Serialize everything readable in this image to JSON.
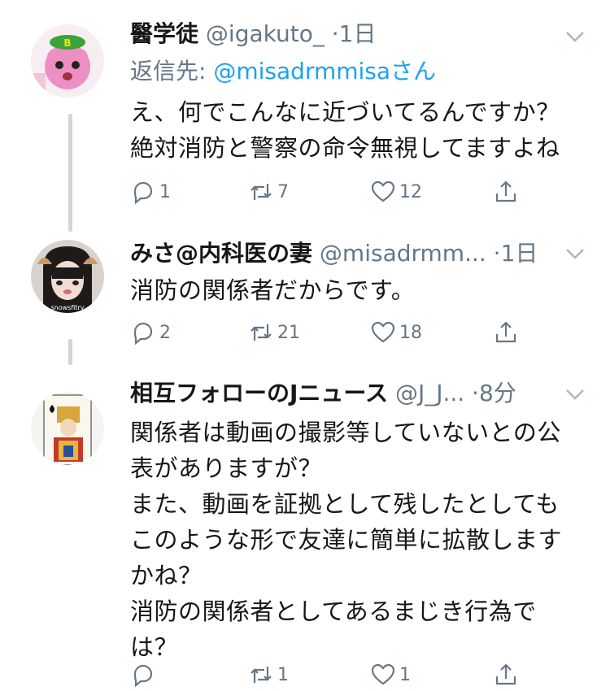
{
  "tweets": [
    {
      "name": "醫学徒",
      "handle": "@igakuto_",
      "sep": " ·",
      "time": "1日",
      "reply_label": "返信先: ",
      "reply_handle": "@misadrmmisa",
      "reply_suffix": "さん",
      "lines": [
        "え、何でこんなに近づいてるんですか？",
        "絶対消防と警察の命令無視してますよね"
      ],
      "replies": "1",
      "retweets": "7",
      "likes": "12"
    },
    {
      "name": "みさ@内科医の妻",
      "handle": "@misadrmm...",
      "sep": " ·",
      "time": "1日",
      "lines": [
        "消防の関係者だからです。"
      ],
      "replies": "2",
      "retweets": "21",
      "likes": "18",
      "avatar_text": "snowsfitry"
    },
    {
      "name": "相互フォローのJニュース",
      "handle": "@J_J...",
      "sep": " ·",
      "time": "8分",
      "lines": [
        "関係者は動画の撮影等していないとの公",
        "表がありますが？",
        "また、動画を証拠として残したとしても",
        "このような形で友達に簡単に拡散します",
        "かね？",
        "消防の関係者としてあるまじき行為で",
        "は？"
      ],
      "replies": "",
      "retweets": "1",
      "likes": "1"
    }
  ],
  "icons": [
    "reply-icon",
    "retweet-icon",
    "like-icon",
    "share-icon",
    "chevron-down-icon"
  ],
  "colors": {
    "accent": "#1da1f2",
    "muted": "#657786",
    "text": "#14171a",
    "thread": "#cfd6dc"
  }
}
